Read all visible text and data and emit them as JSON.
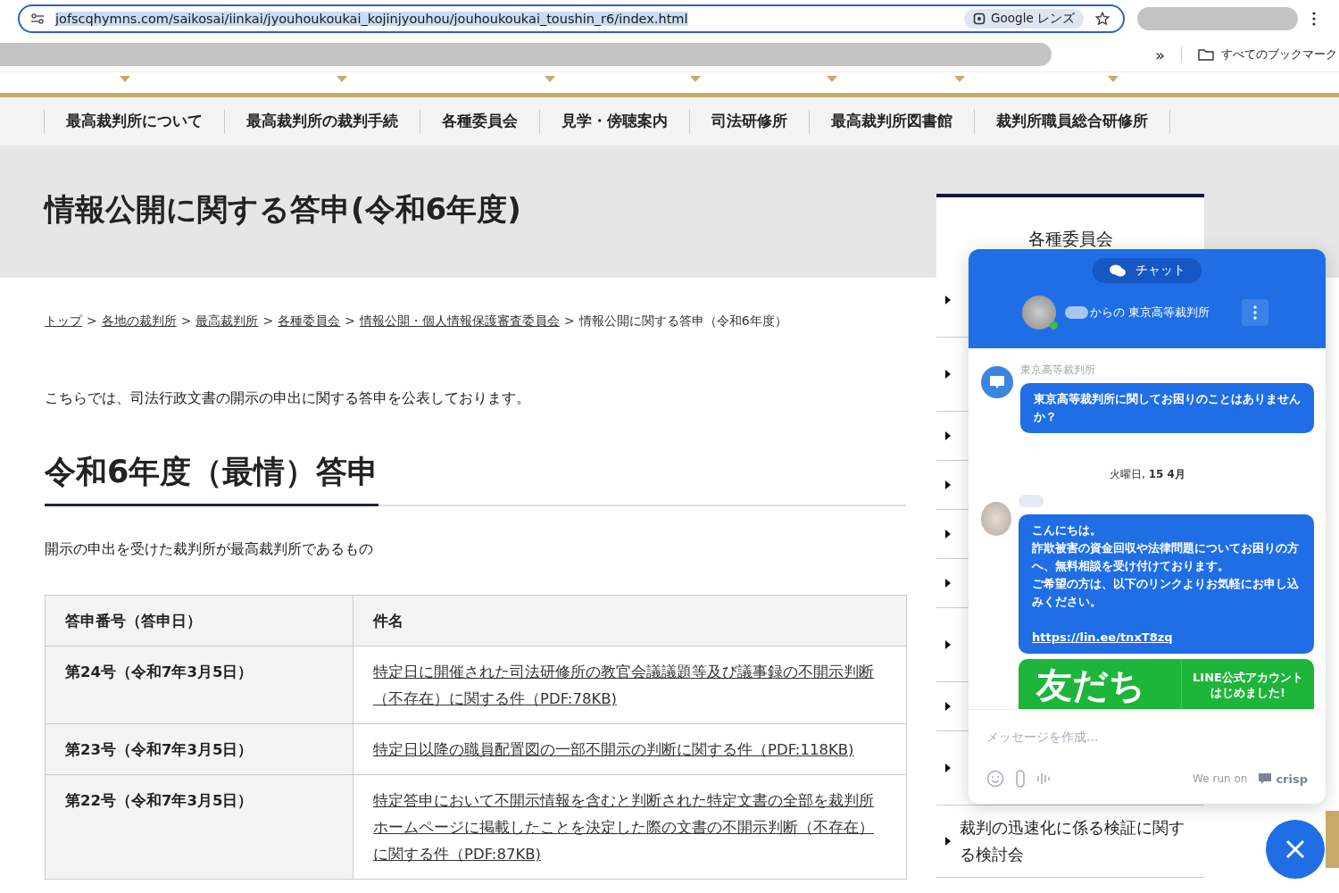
{
  "browser": {
    "url": "jofscqhymns.com/saikosai/iinkai/jyouhoukoukai_kojinjyouhou/jouhoukoukai_toushin_r6/index.html",
    "lens_button": "Google レンズ",
    "overflow": "»",
    "bookmarks_folder": "すべてのブックマーク"
  },
  "nav": [
    "最高裁判所について",
    "最高裁判所の裁判手続",
    "各種委員会",
    "見学・傍聴案内",
    "司法研修所",
    "最高裁判所図書館",
    "裁判所職員総合研修所"
  ],
  "page_title": "情報公開に関する答申(令和6年度)",
  "breadcrumb": {
    "separator": ">",
    "items": [
      {
        "label": "トップ",
        "link": true
      },
      {
        "label": "各地の裁判所",
        "link": true
      },
      {
        "label": "最高裁判所",
        "link": true
      },
      {
        "label": "各種委員会",
        "link": true
      },
      {
        "label": "情報公開・個人情報保護審査委員会",
        "link": true
      },
      {
        "label": "情報公開に関する答申（令和6年度）",
        "link": false
      }
    ]
  },
  "intro": "こちらでは、司法行政文書の開示の申出に関する答申を公表しております。",
  "section_title": "令和6年度（最情）答申",
  "subsection": "開示の申出を受けた裁判所が最高裁判所であるもの",
  "table": {
    "columns": [
      "答申番号（答申日）",
      "件名"
    ],
    "rows": [
      {
        "number": "第24号（令和7年3月5日）",
        "subject": "特定日に開催された司法研修所の教官会議議題等及び議事録の不開示判断（不存在）に関する件（PDF:78KB)"
      },
      {
        "number": "第23号（令和7年3月5日）",
        "subject": "特定日以降の職員配置図の一部不開示の判断に関する件（PDF:118KB)"
      },
      {
        "number": "第22号（令和7年3月5日）",
        "subject": "特定答申において不開示情報を含むと判断された特定文書の全部を裁判所ホームページに掲載したことを決定した際の文書の不開示判断（不存在）に関する件（PDF:87KB)"
      }
    ]
  },
  "sidebar": {
    "title": "各種委員会",
    "items": [
      {
        "kind": "covered_tall"
      },
      {
        "kind": "covered_tall"
      },
      {
        "kind": "covered"
      },
      {
        "kind": "covered"
      },
      {
        "kind": "covered"
      },
      {
        "kind": "covered"
      },
      {
        "kind": "covered_tall"
      },
      {
        "kind": "covered"
      },
      {
        "kind": "covered_tall"
      },
      {
        "kind": "link",
        "label": "裁判の迅速化に係る検証に関する検討会"
      }
    ]
  },
  "chat": {
    "tab": "チャット",
    "header_title": "からの 東京高等裁判所",
    "online": true,
    "operator_name": "東京高等裁判所",
    "operator_message": "東京高等裁判所に関してお困りのことはありませんか？",
    "date": "火曜日, **15 4月**",
    "visitor_message_lines": [
      "こんにちは。",
      "詐欺被害の資金回収や法律問題についてお困りの方へ、無料相談を受け付けております。",
      "ご希望の方は、以下のリンクよりお気軽にお申し込みください。"
    ],
    "link": "https://lin.ee/tnxT8zq",
    "banner": {
      "headline": "友だち",
      "lines": [
        "LINE公式アカウント",
        "はじめました!"
      ]
    },
    "placeholder": "メッセージを作成...",
    "branding": {
      "prefix": "We run on",
      "brand": "crisp"
    }
  }
}
